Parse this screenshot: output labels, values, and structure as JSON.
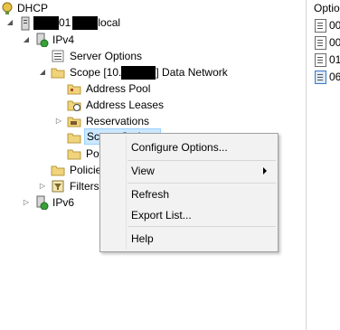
{
  "tree": {
    "root_label": "DHCP",
    "server_prefix": "01",
    "server_suffix": "local",
    "ipv4_label": "IPv4",
    "server_options_label": "Server Options",
    "scope_prefix": "Scope [10.",
    "scope_suffix": "] Data Network",
    "address_pool_label": "Address Pool",
    "address_leases_label": "Address Leases",
    "reservations_label": "Reservations",
    "scope_options_label": "Scope Options",
    "policies_sub_label": "Policies",
    "policies_label": "Policies",
    "filters_label": "Filters",
    "ipv6_label": "IPv6"
  },
  "right_pane": {
    "header": "Optio",
    "rows": [
      "00",
      "00",
      "01",
      "06"
    ]
  },
  "context_menu": {
    "items": [
      "Configure Options...",
      "View",
      "Refresh",
      "Export List...",
      "Help"
    ]
  }
}
